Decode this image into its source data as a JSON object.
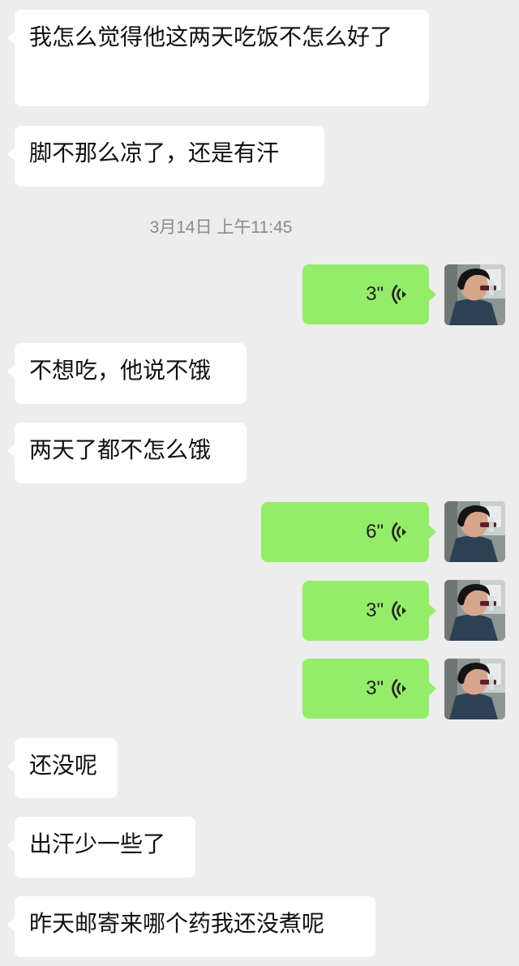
{
  "colors": {
    "background": "#ededed",
    "incoming_bubble": "#ffffff",
    "outgoing_bubble": "#95ec69",
    "timestamp_text": "#8a8a8a"
  },
  "timestamp": "3月14日 上午11:45",
  "incoming_messages": [
    {
      "text": "我怎么觉得他这两天吃饭不怎么好了"
    },
    {
      "text": "脚不那么凉了，还是有汗"
    },
    {
      "text": "不想吃，他说不饿"
    },
    {
      "text": "两天了都不怎么饿"
    },
    {
      "text": "还没呢"
    },
    {
      "text": "出汗少一些了"
    },
    {
      "text": "昨天邮寄来哪个药我还没煮呢"
    }
  ],
  "outgoing_voice_messages": [
    {
      "duration": "3\"",
      "icon": "voice-wave-icon",
      "avatar": "sender-avatar"
    },
    {
      "duration": "6\"",
      "icon": "voice-wave-icon",
      "avatar": "sender-avatar"
    },
    {
      "duration": "3\"",
      "icon": "voice-wave-icon",
      "avatar": "sender-avatar"
    },
    {
      "duration": "3\"",
      "icon": "voice-wave-icon",
      "avatar": "sender-avatar"
    }
  ]
}
